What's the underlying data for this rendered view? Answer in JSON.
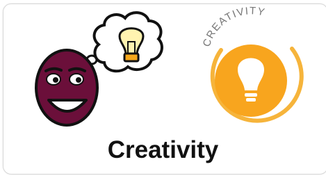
{
  "card": {
    "label": "Creativity",
    "badge_text": "CREATIVITY"
  },
  "icons": {
    "left": "thinking-face-lightbulb-icon",
    "right": "creativity-lightbulb-badge-icon"
  },
  "colors": {
    "face": "#6b0f3a",
    "bulb_glass": "#ffe27a",
    "bulb_base": "#f7a81b",
    "badge_orange": "#f8a51e",
    "badge_ring": "#f6b43b",
    "badge_text": "#777777"
  }
}
